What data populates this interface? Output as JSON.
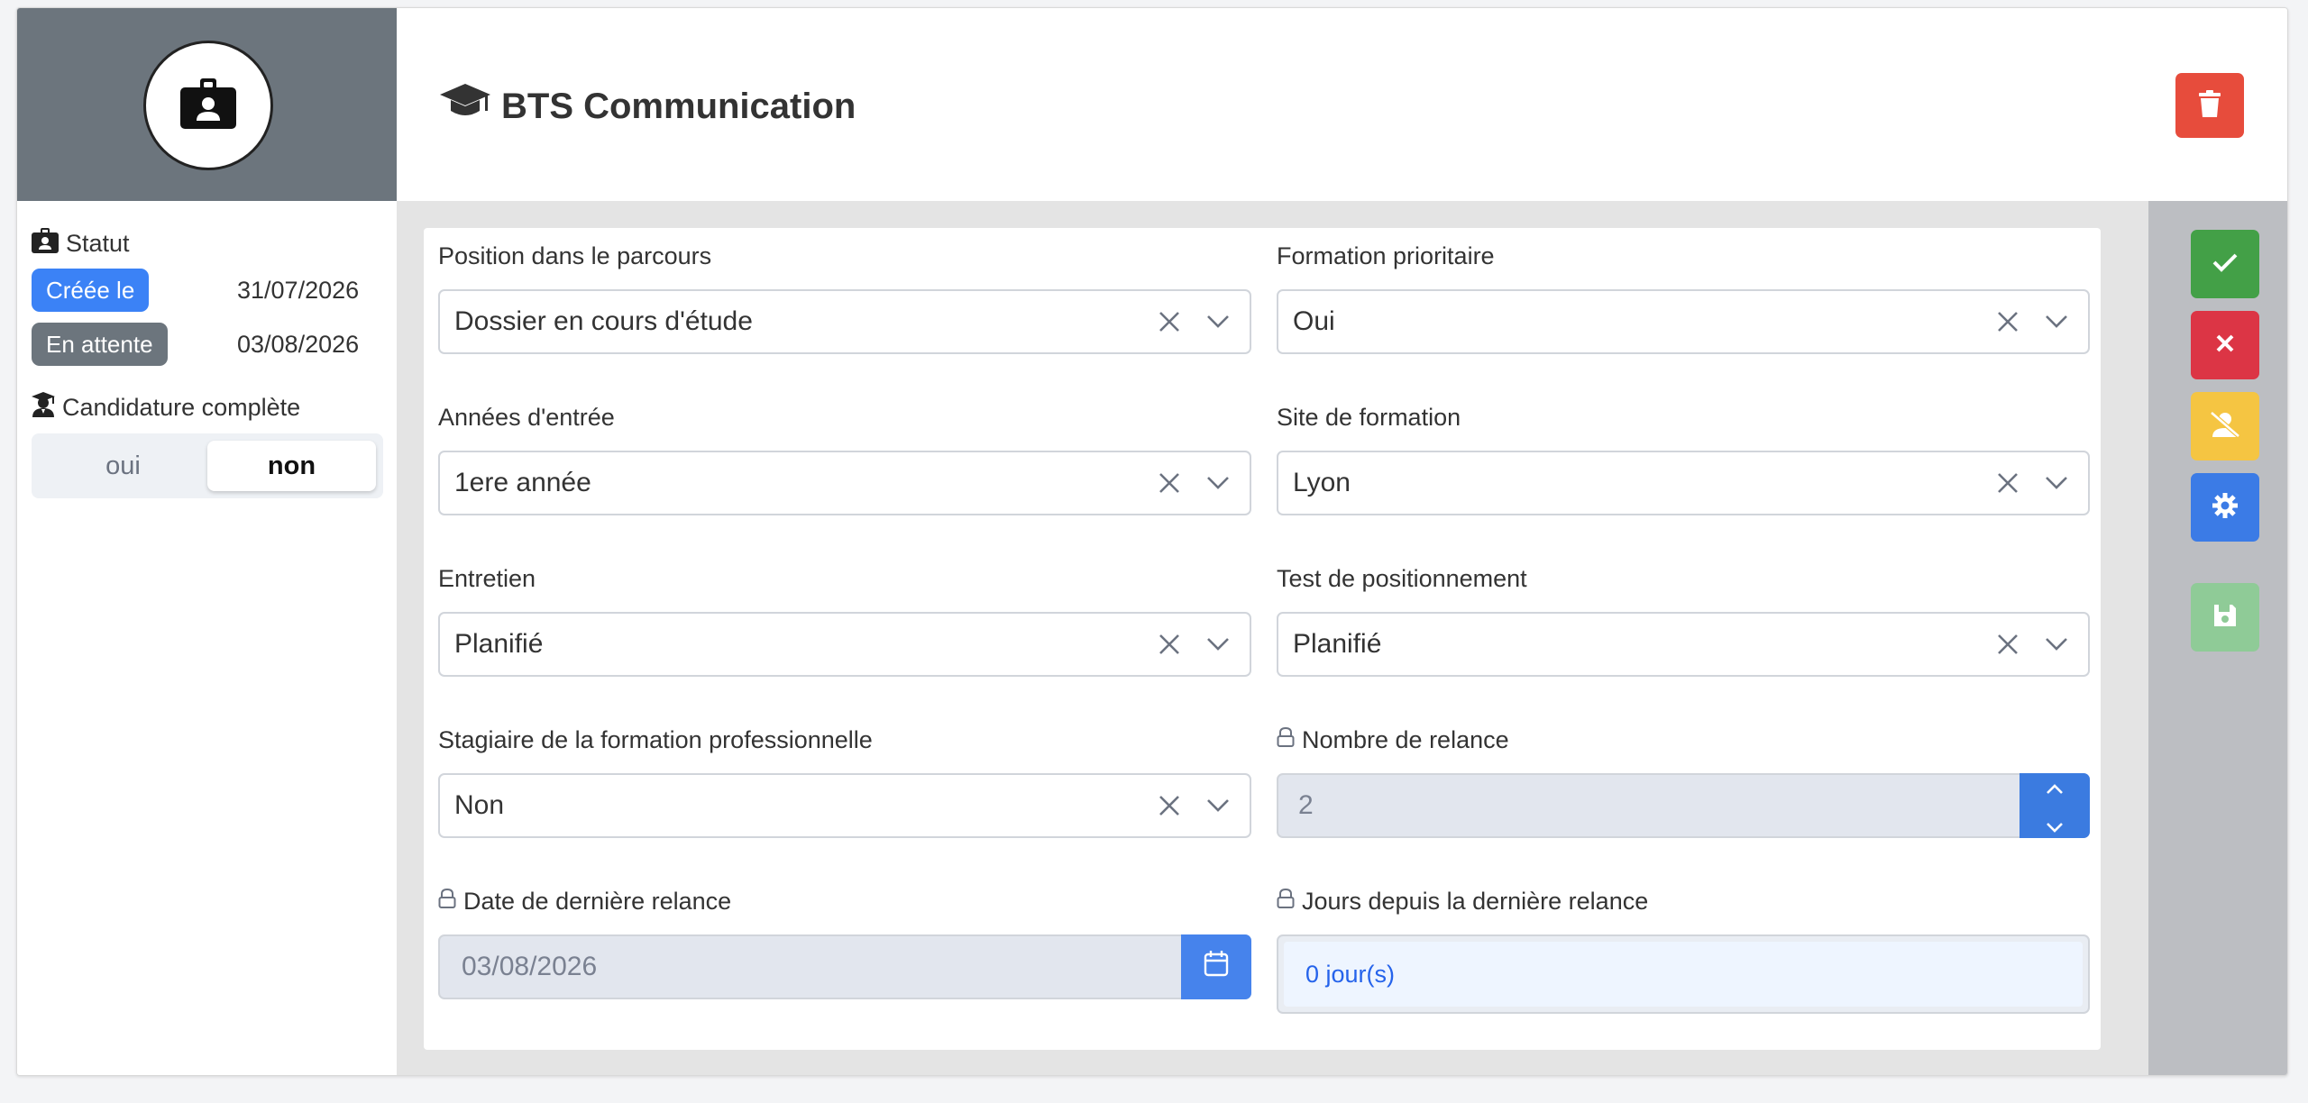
{
  "header": {
    "title": "BTS Communication"
  },
  "status": {
    "title": "Statut",
    "rows": [
      {
        "badge": "Créée le",
        "date": "31/07/2026"
      },
      {
        "badge": "En attente",
        "date": "03/08/2026"
      }
    ]
  },
  "candidature": {
    "title": "Candidature complète",
    "options": [
      "oui",
      "non"
    ],
    "selected": "non"
  },
  "fields": {
    "position": {
      "label": "Position dans le parcours",
      "value": "Dossier en cours d'étude"
    },
    "prioritaire": {
      "label": "Formation prioritaire",
      "value": "Oui"
    },
    "annees": {
      "label": "Années d'entrée",
      "value": "1ere année"
    },
    "site": {
      "label": "Site de formation",
      "value": "Lyon"
    },
    "entretien": {
      "label": "Entretien",
      "value": "Planifié"
    },
    "test": {
      "label": "Test de positionnement",
      "value": "Planifié"
    },
    "stagiaire": {
      "label": "Stagiaire de la formation professionnelle",
      "value": "Non"
    },
    "relance": {
      "label": "Nombre de relance",
      "value": "2"
    },
    "date_relance": {
      "label": "Date de dernière relance",
      "value": "03/08/2026"
    },
    "jours": {
      "label": "Jours depuis la dernière relance",
      "value": "0 jour(s)"
    }
  },
  "actions": [
    "check-icon",
    "times-icon",
    "user-slash-icon",
    "gear-icon",
    "save-icon"
  ],
  "colors": {
    "primary": "#3b82f6",
    "danger": "#e74c3c",
    "success": "#43a047",
    "warning": "#f5c542",
    "sidebar": "#6c757d"
  }
}
